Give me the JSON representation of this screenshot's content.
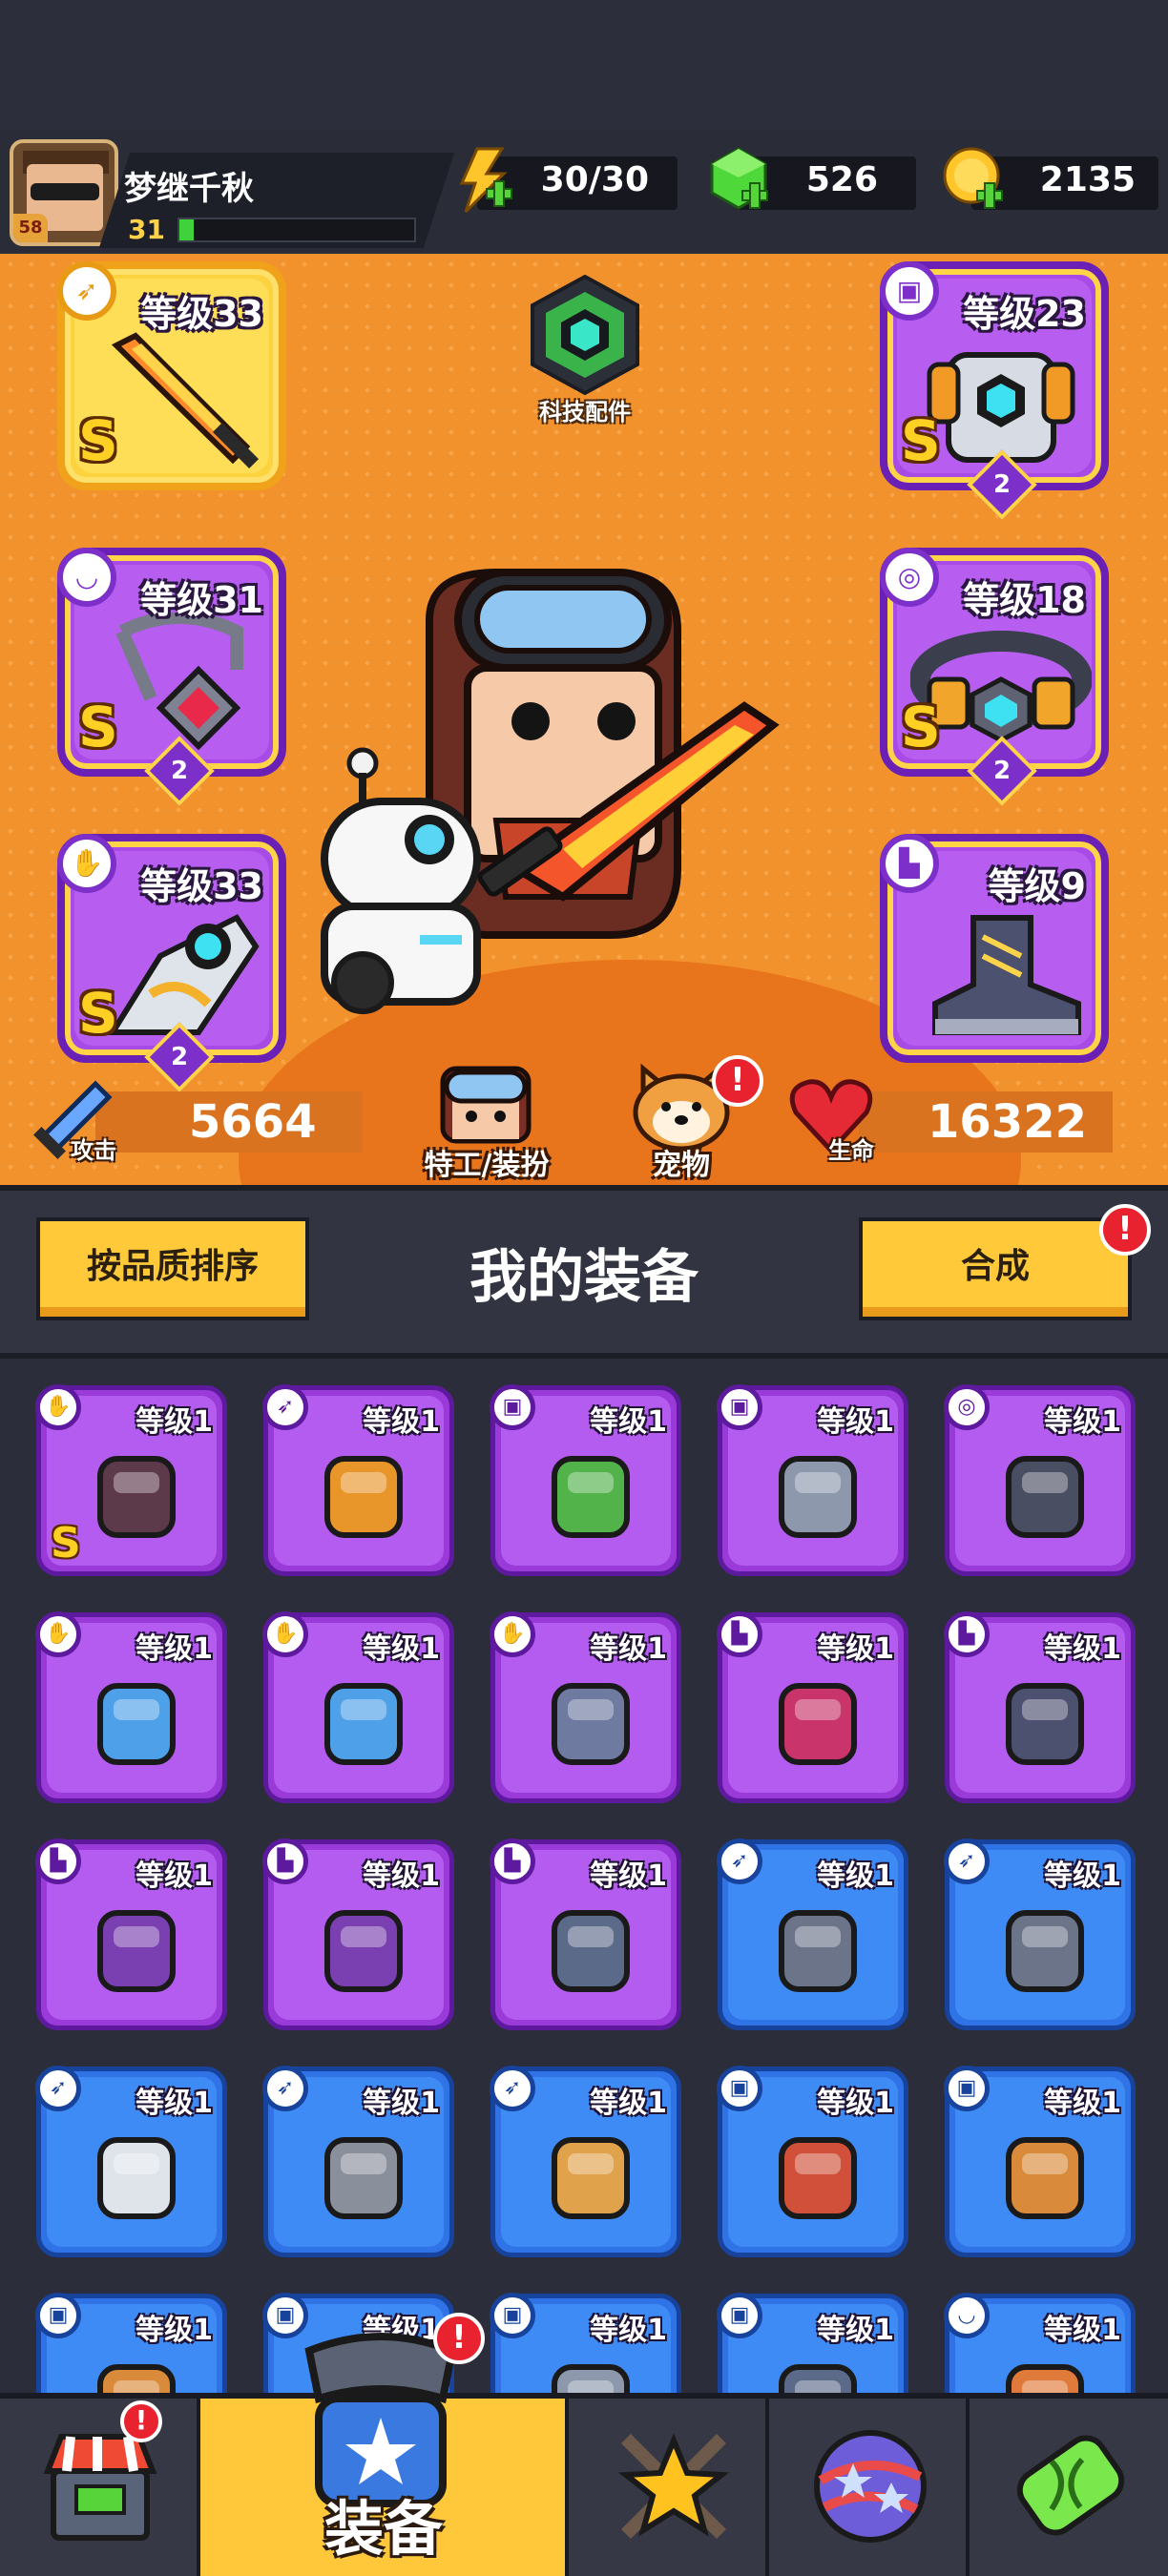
{
  "player": {
    "name": "梦继千秋",
    "level": "31",
    "avatar_level": "58",
    "xp_fraction": 0.06
  },
  "resources": {
    "energy": "30/30",
    "gems": "526",
    "coins": "2135"
  },
  "equipped": {
    "weapon": {
      "level": "等级33",
      "rarity": "S",
      "icon": "sword-icon",
      "type_icon": "weapon-type-icon"
    },
    "armor": {
      "level": "等级23",
      "rarity": "S",
      "count": "2",
      "icon": "armor-icon",
      "type_icon": "shirt-type-icon"
    },
    "necklace": {
      "level": "等级31",
      "rarity": "S",
      "count": "2",
      "icon": "necklace-icon",
      "type_icon": "necklace-type-icon"
    },
    "belt": {
      "level": "等级18",
      "rarity": "S",
      "count": "2",
      "icon": "belt-icon",
      "type_icon": "belt-type-icon"
    },
    "gloves": {
      "level": "等级33",
      "rarity": "S",
      "count": "2",
      "icon": "gauntlet-icon",
      "type_icon": "glove-type-icon"
    },
    "boots": {
      "level": "等级9",
      "icon": "boots-icon",
      "type_icon": "boot-type-icon"
    }
  },
  "tech_parts": {
    "label": "科技配件",
    "icon": "tech-hex-icon"
  },
  "stats": {
    "attack_label": "攻击",
    "attack_value": "5664",
    "hp_label": "生命",
    "hp_value": "16322"
  },
  "menus": {
    "agent_label": "特工/装扮",
    "pet_label": "宠物",
    "pet_alert": "!"
  },
  "inventory": {
    "title": "我的装备",
    "sort_button": "按品质排序",
    "merge_button": "合成",
    "merge_alert": "!",
    "items": [
      {
        "level": "等级1",
        "rarity_color": "purple",
        "s": "S",
        "icon": "claw-gauntlet-icon"
      },
      {
        "level": "等级1",
        "rarity_color": "purple",
        "icon": "torch-icon"
      },
      {
        "level": "等级1",
        "rarity_color": "purple",
        "icon": "leaf-armor-icon"
      },
      {
        "level": "等级1",
        "rarity_color": "purple",
        "icon": "steel-armor-icon"
      },
      {
        "level": "等级1",
        "rarity_color": "purple",
        "icon": "belt-icon"
      },
      {
        "level": "等级1",
        "rarity_color": "purple",
        "icon": "fur-glove-icon"
      },
      {
        "level": "等级1",
        "rarity_color": "purple",
        "icon": "fur-glove-icon"
      },
      {
        "level": "等级1",
        "rarity_color": "purple",
        "icon": "mech-glove-icon"
      },
      {
        "level": "等级1",
        "rarity_color": "purple",
        "icon": "spike-boot-icon"
      },
      {
        "level": "等级1",
        "rarity_color": "purple",
        "icon": "boots-icon"
      },
      {
        "level": "等级1",
        "rarity_color": "purple",
        "icon": "sneaker-icon"
      },
      {
        "level": "等级1",
        "rarity_color": "purple",
        "icon": "sneaker-icon"
      },
      {
        "level": "等级1",
        "rarity_color": "purple",
        "icon": "tech-boot-icon"
      },
      {
        "level": "等级1",
        "rarity_color": "blue",
        "icon": "kunai-icon"
      },
      {
        "level": "等级1",
        "rarity_color": "blue",
        "icon": "kunai-icon"
      },
      {
        "level": "等级1",
        "rarity_color": "blue",
        "icon": "katana-icon"
      },
      {
        "level": "等级1",
        "rarity_color": "blue",
        "icon": "revolver-icon"
      },
      {
        "level": "等级1",
        "rarity_color": "blue",
        "icon": "bat-icon"
      },
      {
        "level": "等级1",
        "rarity_color": "blue",
        "icon": "red-vest-icon"
      },
      {
        "level": "等级1",
        "rarity_color": "blue",
        "icon": "jacket-icon"
      },
      {
        "level": "等级1",
        "rarity_color": "blue",
        "icon": "jacket-icon"
      },
      {
        "level": "等级1",
        "rarity_color": "blue",
        "icon": "armor-icon"
      },
      {
        "level": "等级1",
        "rarity_color": "blue",
        "icon": "steel-armor-icon"
      },
      {
        "level": "等级1",
        "rarity_color": "blue",
        "icon": "vest-icon"
      },
      {
        "level": "等级1",
        "rarity_color": "blue",
        "icon": "necklace-icon"
      }
    ]
  },
  "nav": {
    "shop_alert": "!",
    "equip_label": "装备",
    "equip_alert": "!",
    "tabs": [
      "shop-icon",
      "equipment-icon",
      "battle-star-icon",
      "planet-icon",
      "dna-capsule-icon"
    ]
  },
  "colors": {
    "background_orange": "#f2922d",
    "purple_rarity": "#a84ae6",
    "blue_rarity": "#2f73e6",
    "gold_rarity": "#fdd23f",
    "button_yellow": "#ffc93a",
    "alert_red": "#e8232f"
  }
}
